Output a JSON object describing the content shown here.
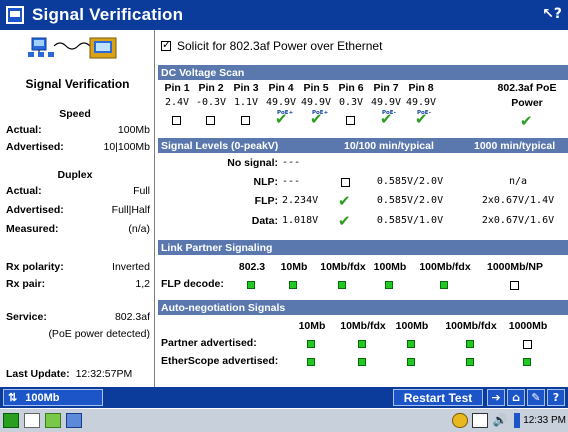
{
  "window": {
    "title": "Signal Verification"
  },
  "left": {
    "heading": "Signal Verification",
    "speed": {
      "heading": "Speed",
      "actual_label": "Actual:",
      "actual": "100Mb",
      "advertised_label": "Advertised:",
      "advertised": "10|100Mb"
    },
    "duplex": {
      "heading": "Duplex",
      "actual_label": "Actual:",
      "actual": "Full",
      "advertised_label": "Advertised:",
      "advertised": "Full|Half",
      "measured_label": "Measured:",
      "measured": "(n/a)"
    },
    "rx_polarity_label": "Rx polarity:",
    "rx_polarity": "Inverted",
    "rx_pair_label": "Rx pair:",
    "rx_pair": "1,2",
    "service_label": "Service:",
    "service": "802.3af",
    "service_note": "(PoE power detected)",
    "last_update_label": "Last Update:",
    "last_update": "12:32:57PM"
  },
  "solicit": {
    "label": "Solicit for 802.3af Power over Ethernet",
    "checked": true
  },
  "dc_scan": {
    "title": "DC Voltage Scan",
    "pins": [
      "Pin 1",
      "Pin 2",
      "Pin 3",
      "Pin 4",
      "Pin 5",
      "Pin 6",
      "Pin 7",
      "Pin 8"
    ],
    "values": [
      "2.4V",
      "-0.3V",
      "1.1V",
      "49.9V",
      "49.9V",
      "0.3V",
      "49.9V",
      "49.9V"
    ],
    "poe_marks": [
      "",
      "",
      "",
      "PoE+",
      "PoE+",
      "",
      "PoE-",
      "PoE-"
    ],
    "power_header": "802.3af PoE",
    "power_label": "Power"
  },
  "signal_levels": {
    "title": "Signal Levels (0-peakV)",
    "col1": "10/100 min/typical",
    "col2": "1000 min/typical",
    "rows": [
      {
        "label": "No signal:",
        "value": "---",
        "mark": "",
        "c1": "",
        "c2": ""
      },
      {
        "label": "NLP:",
        "value": "---",
        "mark": "box",
        "c1": "0.585V/2.0V",
        "c2": "n/a"
      },
      {
        "label": "FLP:",
        "value": "2.234V",
        "mark": "check",
        "c1": "0.585V/2.0V",
        "c2": "2x0.67V/1.4V"
      },
      {
        "label": "Data:",
        "value": "1.018V",
        "mark": "check",
        "c1": "0.585V/1.0V",
        "c2": "2x0.67V/1.6V"
      }
    ]
  },
  "link_partner": {
    "title": "Link Partner Signaling",
    "headers": [
      "802.3",
      "10Mb",
      "10Mb/fdx",
      "100Mb",
      "100Mb/fdx",
      "1000Mb/NP"
    ],
    "row_label": "FLP decode:",
    "states": [
      "green",
      "green",
      "green",
      "green",
      "green",
      "white"
    ]
  },
  "autoneg": {
    "title": "Auto-negotiation Signals",
    "headers": [
      "10Mb",
      "10Mb/fdx",
      "100Mb",
      "100Mb/fdx",
      "1000Mb"
    ],
    "rows": [
      {
        "label": "Partner advertised:",
        "states": [
          "green",
          "green",
          "green",
          "green",
          "white"
        ]
      },
      {
        "label": "EtherScope advertised:",
        "states": [
          "green",
          "green",
          "green",
          "green",
          "green"
        ]
      }
    ]
  },
  "bottom": {
    "speed_button": "100Mb",
    "restart_button": "Restart Test"
  },
  "taskbar": {
    "clock": "12:33 PM"
  },
  "colors": {
    "titlebar": "#0b3c9c",
    "section": "#5a78ad",
    "active": "#22c822",
    "check": "#2a9e1e"
  }
}
